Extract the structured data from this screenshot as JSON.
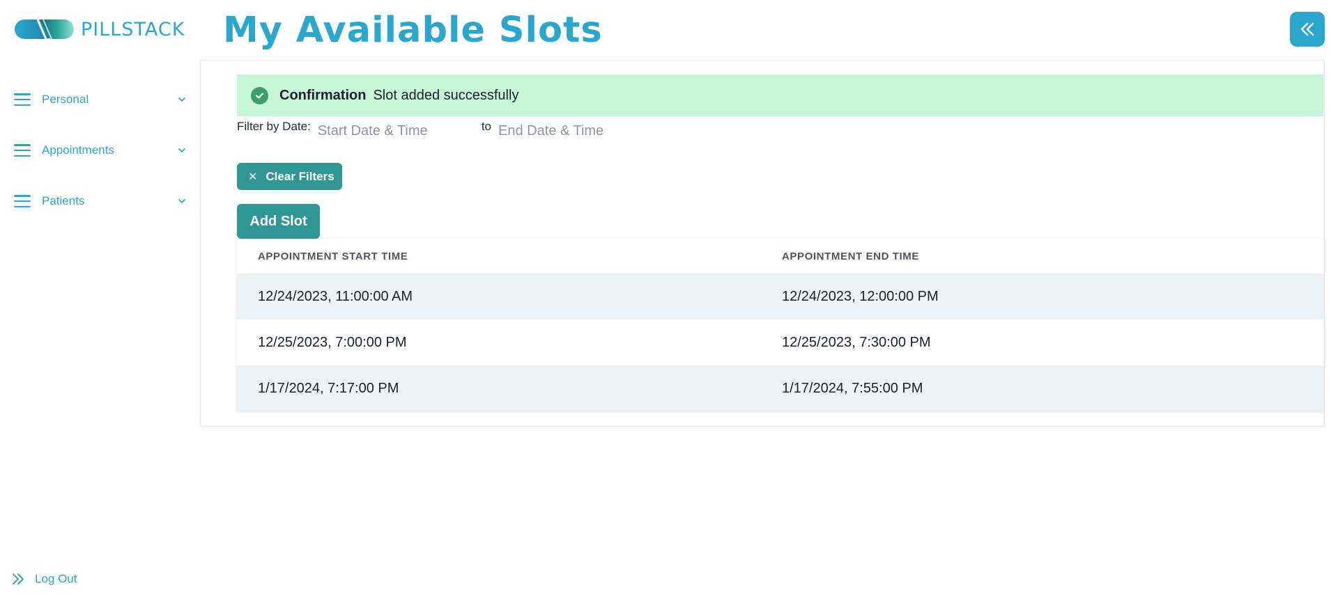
{
  "app": {
    "brand": "PILLSTACK",
    "accent": "#2aa7cf",
    "button_color": "#319795"
  },
  "sidebar": {
    "items": [
      {
        "label": "Personal",
        "icon": "menu-icon"
      },
      {
        "label": "Appointments",
        "icon": "menu-icon"
      },
      {
        "label": "Patients",
        "icon": "menu-icon"
      }
    ],
    "logout_label": "Log Out"
  },
  "header": {
    "title": "My Available Slots"
  },
  "alert": {
    "title": "Confirmation",
    "message": "Slot added successfully",
    "color": "#c6f6d5"
  },
  "filter": {
    "label": "Filter by Date:",
    "start_placeholder": "Start Date & Time",
    "to_label": "to",
    "end_placeholder": "End Date & Time"
  },
  "buttons": {
    "clear_filters": "Clear Filters",
    "add_slot": "Add Slot"
  },
  "table": {
    "columns": [
      "APPOINTMENT START TIME",
      "APPOINTMENT END TIME"
    ],
    "rows": [
      [
        "12/24/2023, 11:00:00 AM",
        "12/24/2023, 12:00:00 PM"
      ],
      [
        "12/25/2023, 7:00:00 PM",
        "12/25/2023, 7:30:00 PM"
      ],
      [
        "1/17/2024, 7:17:00 PM",
        "1/17/2024, 7:55:00 PM"
      ]
    ]
  }
}
